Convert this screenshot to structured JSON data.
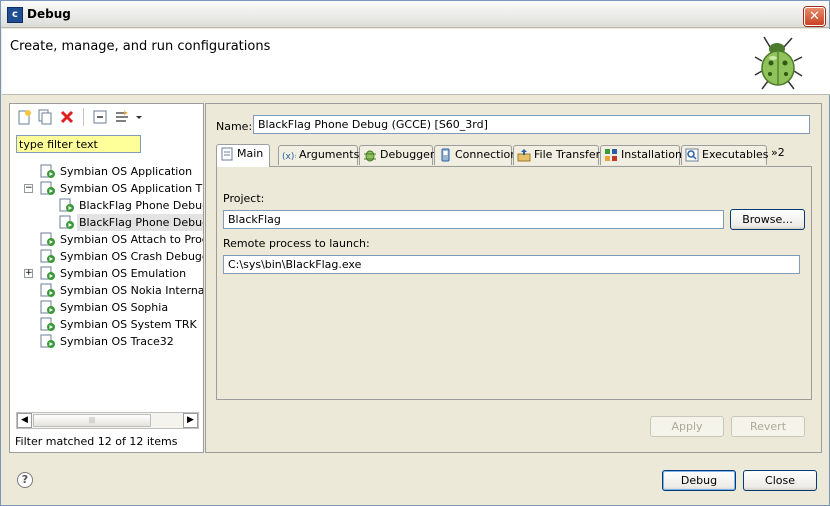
{
  "window": {
    "title": "Debug",
    "header": "Create, manage, and run configurations",
    "close_glyph": "✕"
  },
  "left": {
    "filter_placeholder": "type filter text",
    "filter_value": "type filter text",
    "tree": [
      {
        "label": "Symbian OS Application"
      },
      {
        "label": "Symbian OS Application TRK"
      },
      {
        "label": "BlackFlag Phone Debug (A"
      },
      {
        "label": "BlackFlag Phone Debug (G"
      },
      {
        "label": "Symbian OS Attach to Proces"
      },
      {
        "label": "Symbian OS Crash Debugger"
      },
      {
        "label": "Symbian OS Emulation"
      },
      {
        "label": "Symbian OS Nokia Internal Tr"
      },
      {
        "label": "Symbian OS Sophia"
      },
      {
        "label": "Symbian OS System TRK"
      },
      {
        "label": "Symbian OS Trace32"
      }
    ],
    "status": "Filter matched 12 of 12 items",
    "scroll_thumb_glyph": "|||"
  },
  "right": {
    "name_label": "Name:",
    "name_value": "BlackFlag Phone Debug (GCCE) [S60_3rd]",
    "tabs": [
      {
        "label": "Main",
        "icon": "main-tab-icon"
      },
      {
        "label": "Arguments",
        "icon": "arguments-icon"
      },
      {
        "label": "Debugger",
        "icon": "debugger-icon"
      },
      {
        "label": "Connection",
        "icon": "connection-icon"
      },
      {
        "label": "File Transfer",
        "icon": "file-transfer-icon"
      },
      {
        "label": "Installation",
        "icon": "installation-icon"
      },
      {
        "label": "Executables",
        "icon": "executables-icon"
      }
    ],
    "tab_overflow": "»2",
    "project_label": "Project:",
    "project_value": "BlackFlag",
    "browse_label": "Browse...",
    "remote_label": "Remote process to launch:",
    "remote_value": "C:\\sys\\bin\\BlackFlag.exe",
    "apply_label": "Apply",
    "revert_label": "Revert"
  },
  "footer": {
    "help_glyph": "?",
    "debug_label": "Debug",
    "close_label": "Close"
  },
  "colors": {
    "filter_highlight": "#ffff99",
    "dialog_bg": "#ece9d8",
    "delete_red": "#e02020"
  }
}
